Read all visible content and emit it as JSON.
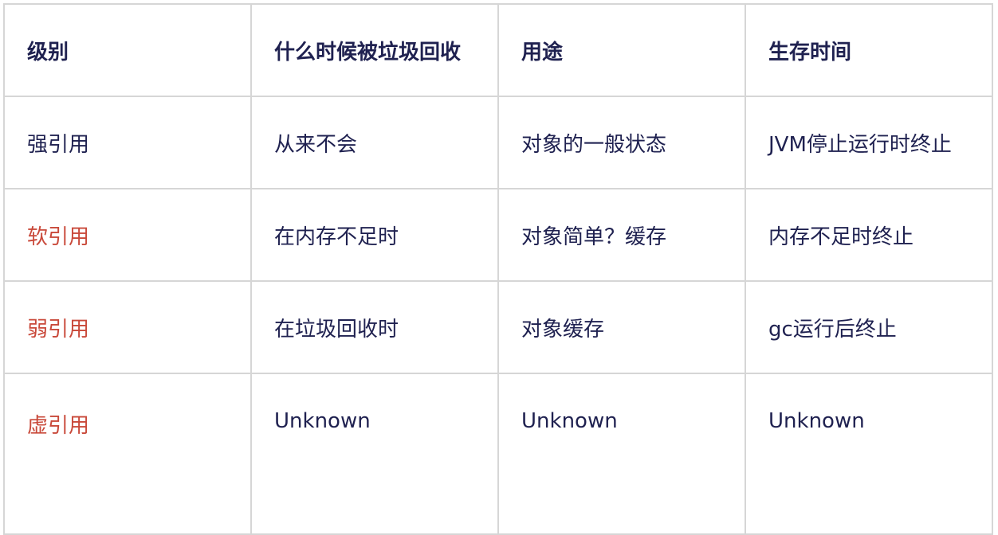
{
  "table": {
    "headers": [
      "级别",
      "什么时候被垃圾回收",
      "用途",
      "生存时间"
    ],
    "rows": [
      [
        "强引用",
        "从来不会",
        "对象的一般状态",
        "JVM停止运行时终止"
      ],
      [
        "软引用",
        "在内存不足时",
        "对象简单？缓存",
        "内存不足时终止"
      ],
      [
        "弱引用",
        "在垃圾回收时",
        "对象缓存",
        "gc运行后终止"
      ],
      [
        "虚引用",
        "Unknown",
        "Unknown",
        "Unknown"
      ]
    ]
  },
  "colors": {
    "text": "#1f2150",
    "highlight": "#c9493a",
    "border": "#d6d6d6"
  }
}
